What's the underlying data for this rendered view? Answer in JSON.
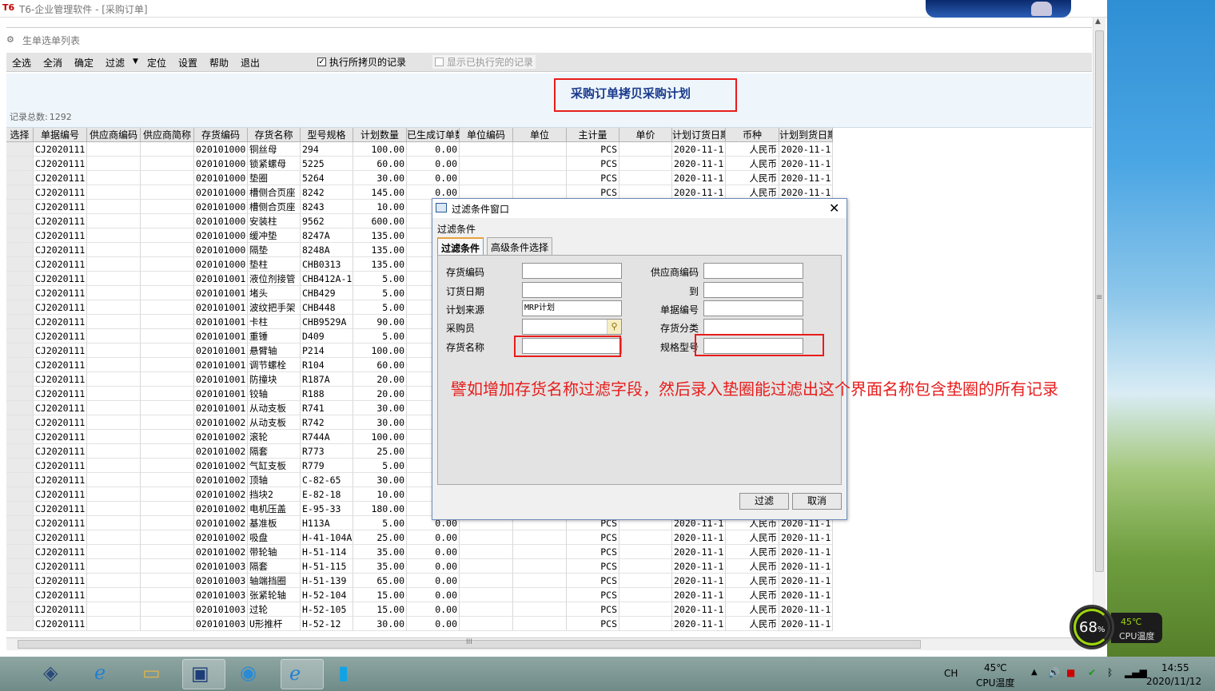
{
  "window": {
    "logo": "T6",
    "title": "T6-企业管理软件 - [采购订单]"
  },
  "doc": {
    "title": "生单选单列表"
  },
  "toolbar": {
    "buttons": [
      "全选",
      "全消",
      "确定",
      "过滤",
      "定位",
      "设置",
      "帮助",
      "退出"
    ],
    "check_execute": "执行所拷贝的记录",
    "check_show_done": "显示已执行完的记录"
  },
  "header": {
    "title": "采购订单拷贝采购计划",
    "record_label": "记录总数:",
    "record_count": "1292"
  },
  "grid": {
    "columns": [
      "选择",
      "单据编号",
      "供应商编码",
      "供应商简称",
      "存货编码",
      "存货名称",
      "型号规格",
      "计划数量",
      "已生成订单数",
      "单位编码",
      "单位",
      "主计量",
      "单价",
      "计划订货日期",
      "币种",
      "计划到货日期"
    ],
    "rows": [
      [
        "",
        "CJ2020111",
        "",
        "",
        "020101000",
        "铜丝母",
        "294",
        "100.00",
        "0.00",
        "",
        "",
        "PCS",
        "",
        "2020-11-1",
        "人民币",
        "2020-11-1"
      ],
      [
        "",
        "CJ2020111",
        "",
        "",
        "020101000",
        "锁紧螺母",
        "5225",
        "60.00",
        "0.00",
        "",
        "",
        "PCS",
        "",
        "2020-11-1",
        "人民币",
        "2020-11-1"
      ],
      [
        "",
        "CJ2020111",
        "",
        "",
        "020101000",
        "垫圈",
        "5264",
        "30.00",
        "0.00",
        "",
        "",
        "PCS",
        "",
        "2020-11-1",
        "人民币",
        "2020-11-1"
      ],
      [
        "",
        "CJ2020111",
        "",
        "",
        "020101000",
        "槽侧合页座",
        "8242",
        "145.00",
        "0.00",
        "",
        "",
        "PCS",
        "",
        "2020-11-1",
        "人民币",
        "2020-11-1"
      ],
      [
        "",
        "CJ2020111",
        "",
        "",
        "020101000",
        "槽侧合页座",
        "8243",
        "10.00",
        "",
        "",
        "",
        "",
        "",
        "",
        "",
        ""
      ],
      [
        "",
        "CJ2020111",
        "",
        "",
        "020101000",
        "安装柱",
        "9562",
        "600.00",
        "",
        "",
        "",
        "",
        "",
        "",
        "",
        ""
      ],
      [
        "",
        "CJ2020111",
        "",
        "",
        "020101000",
        "缓冲垫",
        "8247A",
        "135.00",
        "",
        "",
        "",
        "",
        "",
        "",
        "",
        ""
      ],
      [
        "",
        "CJ2020111",
        "",
        "",
        "020101000",
        "隔垫",
        "8248A",
        "135.00",
        "",
        "",
        "",
        "",
        "",
        "",
        "",
        ""
      ],
      [
        "",
        "CJ2020111",
        "",
        "",
        "020101000",
        "垫柱",
        "CHB0313",
        "135.00",
        "",
        "",
        "",
        "",
        "",
        "",
        "",
        ""
      ],
      [
        "",
        "CJ2020111",
        "",
        "",
        "020101001",
        "液位剂接管",
        "CHB412A-1",
        "5.00",
        "",
        "",
        "",
        "",
        "",
        "",
        "",
        ""
      ],
      [
        "",
        "CJ2020111",
        "",
        "",
        "020101001",
        "堵头",
        "CHB429",
        "5.00",
        "",
        "",
        "",
        "",
        "",
        "",
        "",
        ""
      ],
      [
        "",
        "CJ2020111",
        "",
        "",
        "020101001",
        "波纹把手架",
        "CHB448",
        "5.00",
        "",
        "",
        "",
        "",
        "",
        "",
        "",
        ""
      ],
      [
        "",
        "CJ2020111",
        "",
        "",
        "020101001",
        "卡柱",
        "CHB9529A",
        "90.00",
        "",
        "",
        "",
        "",
        "",
        "",
        "",
        ""
      ],
      [
        "",
        "CJ2020111",
        "",
        "",
        "020101001",
        "重锤",
        "D409",
        "5.00",
        "",
        "",
        "",
        "",
        "",
        "",
        "",
        ""
      ],
      [
        "",
        "CJ2020111",
        "",
        "",
        "020101001",
        "悬臂轴",
        "P214",
        "100.00",
        "",
        "",
        "",
        "",
        "",
        "",
        "",
        ""
      ],
      [
        "",
        "CJ2020111",
        "",
        "",
        "020101001",
        "调节螺栓",
        "R104",
        "60.00",
        "",
        "",
        "",
        "",
        "",
        "",
        "",
        ""
      ],
      [
        "",
        "CJ2020111",
        "",
        "",
        "020101001",
        "防撞块",
        "R187A",
        "20.00",
        "",
        "",
        "",
        "",
        "",
        "",
        "",
        ""
      ],
      [
        "",
        "CJ2020111",
        "",
        "",
        "020101001",
        "铰轴",
        "R188",
        "20.00",
        "",
        "",
        "",
        "",
        "",
        "",
        "",
        ""
      ],
      [
        "",
        "CJ2020111",
        "",
        "",
        "020101001",
        "从动支板",
        "R741",
        "30.00",
        "",
        "",
        "",
        "",
        "",
        "",
        "",
        ""
      ],
      [
        "",
        "CJ2020111",
        "",
        "",
        "020101002",
        "从动支板",
        "R742",
        "30.00",
        "",
        "",
        "",
        "",
        "",
        "",
        "",
        ""
      ],
      [
        "",
        "CJ2020111",
        "",
        "",
        "020101002",
        "滚轮",
        "R744A",
        "100.00",
        "",
        "",
        "",
        "",
        "",
        "",
        "",
        ""
      ],
      [
        "",
        "CJ2020111",
        "",
        "",
        "020101002",
        "隔套",
        "R773",
        "25.00",
        "",
        "",
        "",
        "",
        "",
        "",
        "",
        ""
      ],
      [
        "",
        "CJ2020111",
        "",
        "",
        "020101002",
        "气缸支板",
        "R779",
        "5.00",
        "",
        "",
        "",
        "",
        "",
        "",
        "",
        ""
      ],
      [
        "",
        "CJ2020111",
        "",
        "",
        "020101002",
        "顶轴",
        "C-82-65",
        "30.00",
        "",
        "",
        "",
        "",
        "",
        "",
        "",
        ""
      ],
      [
        "",
        "CJ2020111",
        "",
        "",
        "020101002",
        "挡块2",
        "E-82-18",
        "10.00",
        "",
        "",
        "",
        "",
        "",
        "",
        "",
        ""
      ],
      [
        "",
        "CJ2020111",
        "",
        "",
        "020101002",
        "电机压盖",
        "E-95-33",
        "180.00",
        "",
        "",
        "",
        "",
        "",
        "",
        "",
        ""
      ],
      [
        "",
        "CJ2020111",
        "",
        "",
        "020101002",
        "基准板",
        "H113A",
        "5.00",
        "0.00",
        "",
        "",
        "PCS",
        "",
        "2020-11-1",
        "人民币",
        "2020-11-1"
      ],
      [
        "",
        "CJ2020111",
        "",
        "",
        "020101002",
        "吸盘",
        "H-41-104A",
        "25.00",
        "0.00",
        "",
        "",
        "PCS",
        "",
        "2020-11-1",
        "人民币",
        "2020-11-1"
      ],
      [
        "",
        "CJ2020111",
        "",
        "",
        "020101002",
        "带轮轴",
        "H-51-114",
        "35.00",
        "0.00",
        "",
        "",
        "PCS",
        "",
        "2020-11-1",
        "人民币",
        "2020-11-1"
      ],
      [
        "",
        "CJ2020111",
        "",
        "",
        "020101003",
        "隔套",
        "H-51-115",
        "35.00",
        "0.00",
        "",
        "",
        "PCS",
        "",
        "2020-11-1",
        "人民币",
        "2020-11-1"
      ],
      [
        "",
        "CJ2020111",
        "",
        "",
        "020101003",
        "轴端挡圈",
        "H-51-139",
        "65.00",
        "0.00",
        "",
        "",
        "PCS",
        "",
        "2020-11-1",
        "人民币",
        "2020-11-1"
      ],
      [
        "",
        "CJ2020111",
        "",
        "",
        "020101003",
        "张紧轮轴",
        "H-52-104",
        "15.00",
        "0.00",
        "",
        "",
        "PCS",
        "",
        "2020-11-1",
        "人民币",
        "2020-11-1"
      ],
      [
        "",
        "CJ2020111",
        "",
        "",
        "020101003",
        "过轮",
        "H-52-105",
        "15.00",
        "0.00",
        "",
        "",
        "PCS",
        "",
        "2020-11-1",
        "人民币",
        "2020-11-1"
      ],
      [
        "",
        "CJ2020111",
        "",
        "",
        "020101003",
        "U形推杆",
        "H-52-12",
        "30.00",
        "0.00",
        "",
        "",
        "PCS",
        "",
        "2020-11-1",
        "人民币",
        "2020-11-1"
      ]
    ]
  },
  "dialog": {
    "title": "过滤条件窗口",
    "section": "过滤条件",
    "tabs": [
      "过滤条件",
      "高级条件选择"
    ],
    "fields": {
      "item_code": "存货编码",
      "supplier_code": "供应商编码",
      "order_date": "订货日期",
      "to": "到",
      "plan_source": "计划来源",
      "plan_source_value": "MRP计划",
      "doc_no": "单据编号",
      "buyer": "采购员",
      "item_class": "存货分类",
      "item_name": "存货名称",
      "spec": "规格型号"
    },
    "ok": "过滤",
    "cancel": "取消"
  },
  "annotation": "譬如增加存货名称过滤字段，然后录入垫圈能过滤出这个界面名称包含垫圈的所有记录",
  "taskbar": {
    "lang": "CH",
    "temp": "45℃",
    "cpu_temp_label": "CPU温度",
    "time": "14:55",
    "date": "2020/11/12"
  },
  "monitor": {
    "cpu_percent": "68",
    "temp": "45℃",
    "label": "CPU温度"
  }
}
